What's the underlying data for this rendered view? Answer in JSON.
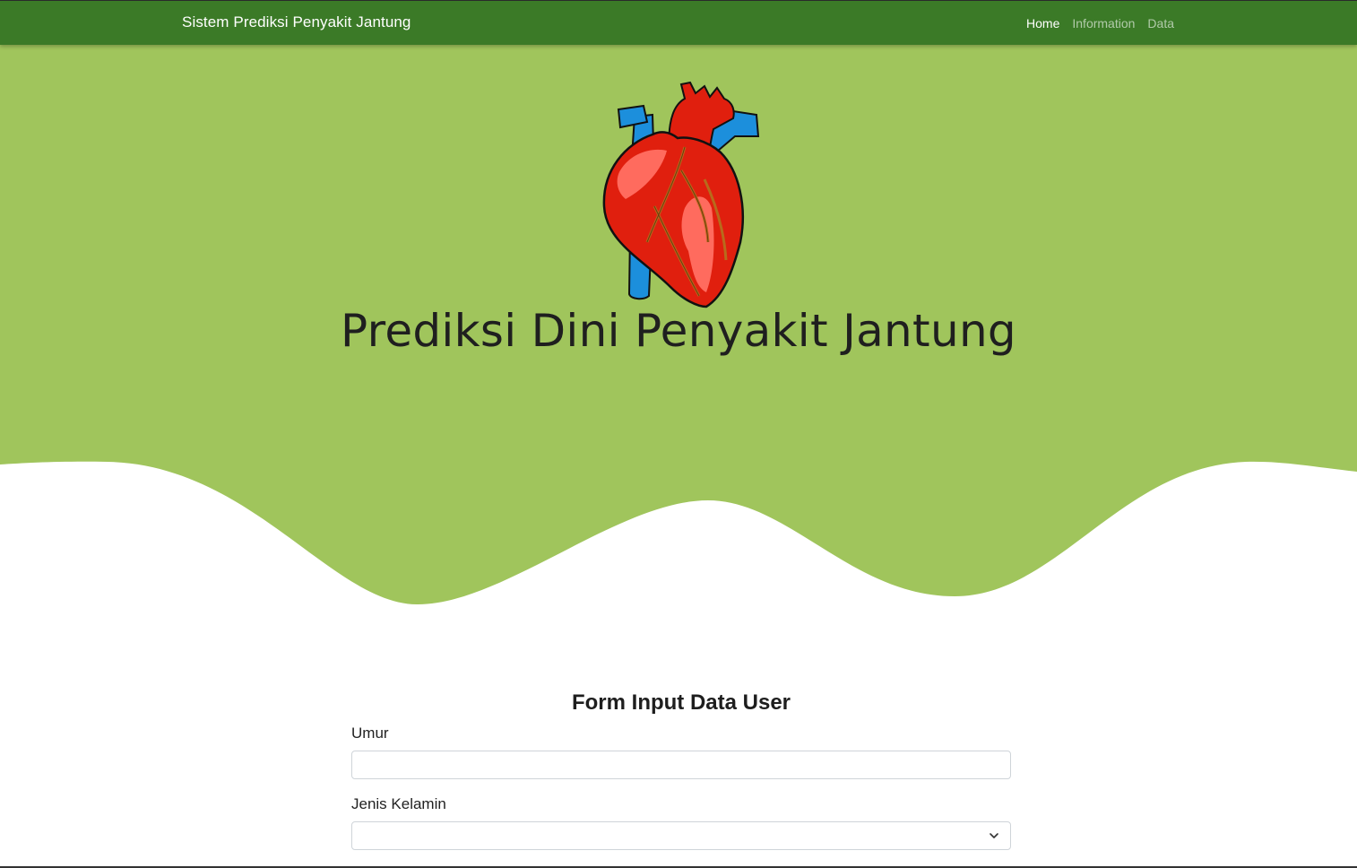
{
  "navbar": {
    "brand": "Sistem Prediksi Penyakit Jantung",
    "links": [
      {
        "label": "Home",
        "active": true
      },
      {
        "label": "Information",
        "active": false
      },
      {
        "label": "Data",
        "active": false
      }
    ]
  },
  "hero": {
    "title": "Prediksi Dini Penyakit Jantung",
    "image": "heart-illustration-icon"
  },
  "form": {
    "title": "Form Input Data User",
    "fields": [
      {
        "label": "Umur",
        "type": "text",
        "value": "",
        "placeholder": ""
      },
      {
        "label": "Jenis Kelamin",
        "type": "select",
        "value": ""
      }
    ]
  },
  "colors": {
    "navbar_bg": "#3b7a27",
    "hero_bg": "#a0c55c",
    "heart_red": "#e01f0e",
    "vessel_blue": "#1c8fdc"
  }
}
